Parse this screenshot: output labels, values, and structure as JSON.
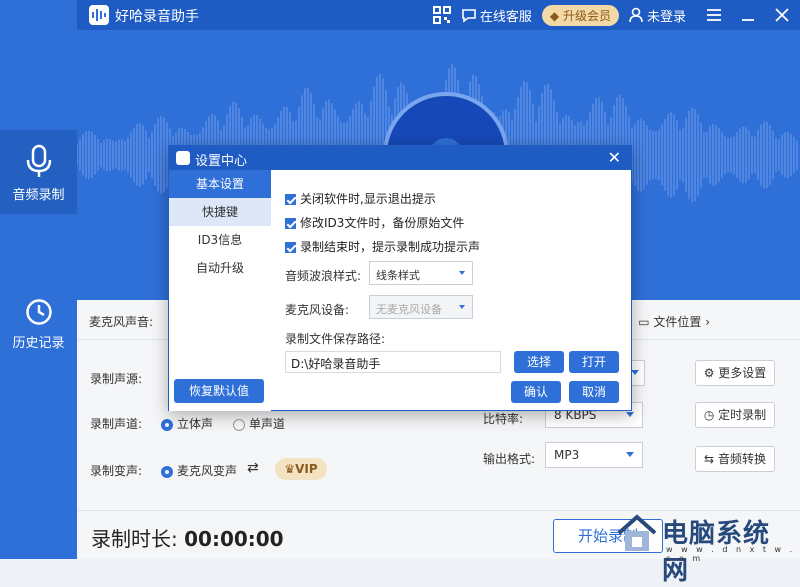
{
  "app": {
    "title": "好哈录音助手"
  },
  "titlebar": {
    "service": "在线客服",
    "vip": "升级会员",
    "login": "未登录"
  },
  "sidebar": {
    "items": [
      {
        "label": "音频录制"
      },
      {
        "label": "历史记录"
      }
    ]
  },
  "toolbar": {
    "mic_label": "麦克风声音:",
    "file_location": "文件位置"
  },
  "controls": {
    "source_label": "录制声源:",
    "channel_label": "录制声道:",
    "channel_options": [
      "立体声",
      "单声道"
    ],
    "voice_label": "录制变声:",
    "voice_option": "麦克风变声",
    "vip_badge": "VIP",
    "bitrate_label": "比特率:",
    "bitrate_value": "8 KBPS",
    "format_label": "输出格式:",
    "format_value": "MP3",
    "more_settings": "更多设置",
    "timed_record": "定时录制",
    "audio_convert": "音频转换"
  },
  "bottom": {
    "duration_label": "录制时长:",
    "duration_value": "00:00:00",
    "start_button": "开始录制"
  },
  "watermark": {
    "text": "电脑系统网",
    "url": "w w w . d n x t w . c o m"
  },
  "dialog": {
    "title": "设置中心",
    "nav": [
      "基本设置",
      "快捷键",
      "ID3信息",
      "自动升级"
    ],
    "restore_button": "恢复默认值",
    "checkboxes": [
      "关闭软件时,显示退出提示",
      "修改ID3文件时，备份原始文件",
      "录制结束时，提示录制成功提示声"
    ],
    "wave_label": "音频波浪样式:",
    "wave_value": "线条样式",
    "mic_label": "麦克风设备:",
    "mic_value": "无麦克风设备",
    "path_label": "录制文件保存路径:",
    "path_value": "D:\\好哈录音助手",
    "select_button": "选择",
    "open_button": "打开",
    "confirm_button": "确认",
    "cancel_button": "取消"
  },
  "colors": {
    "accent": "#2f6fd8",
    "titlebar": "#1e5cc4",
    "vip": "#f3d9a6"
  }
}
